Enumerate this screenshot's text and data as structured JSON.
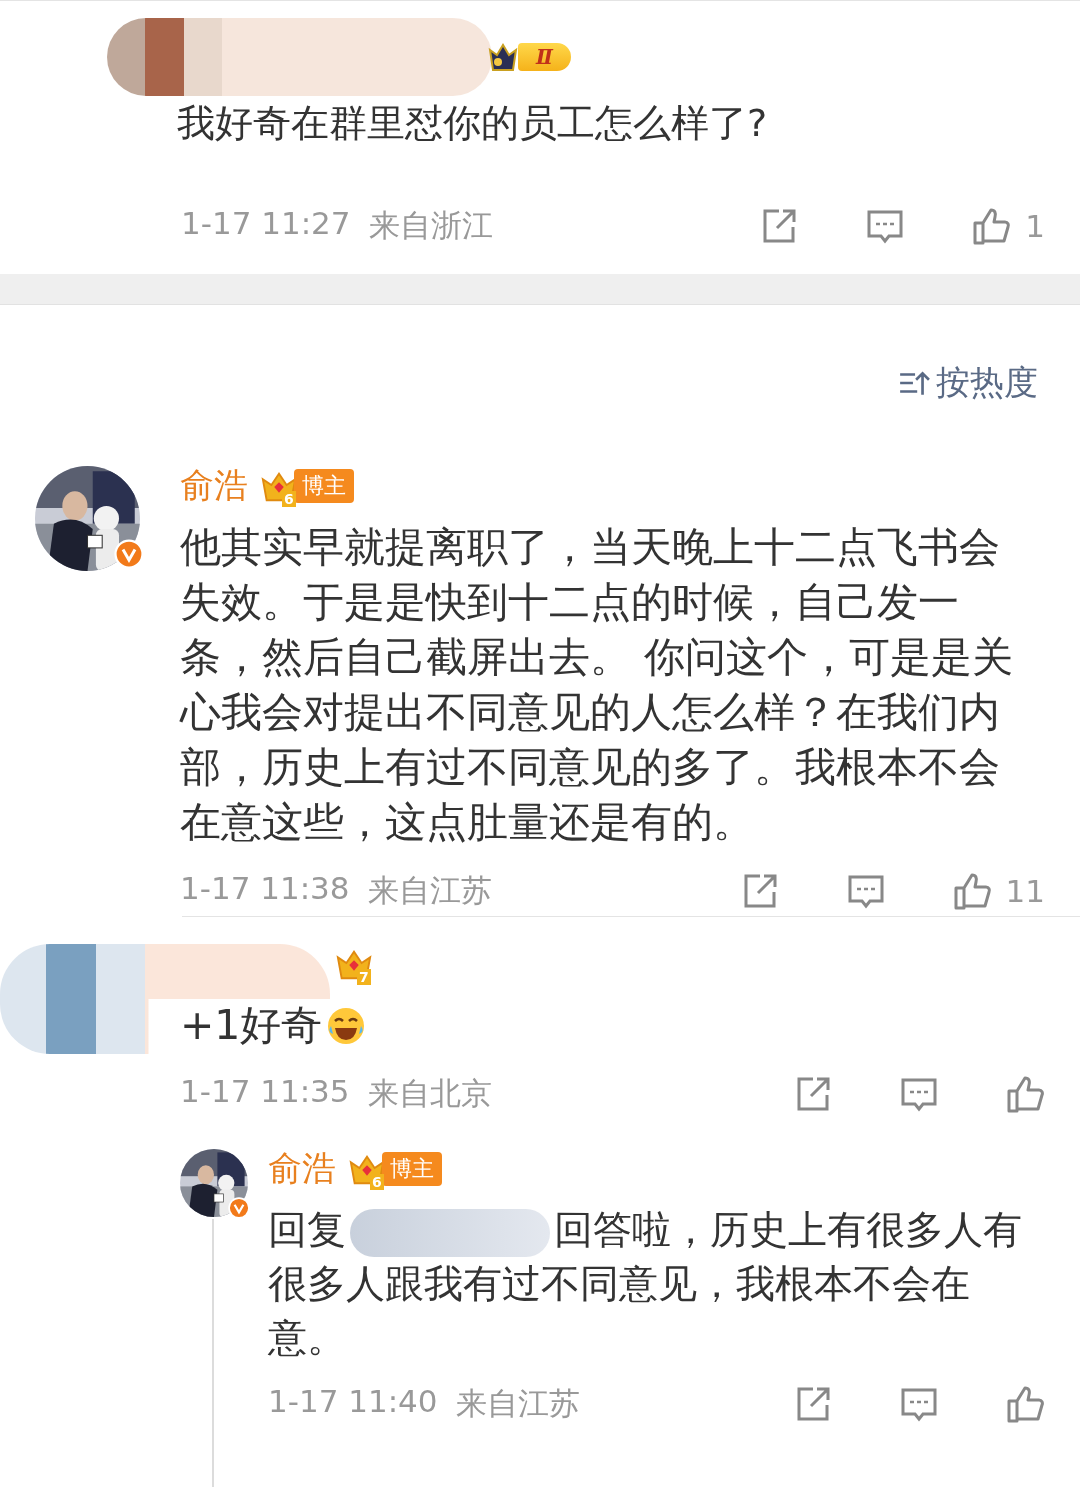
{
  "top_comment": {
    "badge_mark": "Ⅱ",
    "text": "我好奇在群里怼你的员工怎么样了?",
    "time": "1-17 11:27",
    "location": "来自浙江",
    "like_count": "1"
  },
  "sort_button": {
    "label": "按热度"
  },
  "comments": [
    {
      "kind": "blogger",
      "author": "俞浩",
      "level": "6",
      "badge": "博主",
      "verified": true,
      "text": "他其实早就提离职了，当天晚上十二点飞书会失效。于是是快到十二点的时候，自己发一条，然后自己截屏出去。 你问这个，可是是关心我会对提出不同意见的人怎么样？在我们内部，历史上有过不同意见的多了。我根本不会在意这些，这点肚量还是有的。",
      "time": "1-17 11:38",
      "location": "来自江苏",
      "like_count": "11"
    },
    {
      "kind": "hidden",
      "level": "7",
      "text": "+1好奇",
      "time": "1-17 11:35",
      "location": "来自北京",
      "replies": [
        {
          "kind": "blogger",
          "author": "俞浩",
          "level": "6",
          "badge": "博主",
          "verified": true,
          "reply_prefix": "回复",
          "text": "回答啦，历史上有很多人有很多人跟我有过不同意见，我根本不会在意。",
          "time": "1-17 11:40",
          "location": "来自江苏"
        }
      ]
    }
  ]
}
